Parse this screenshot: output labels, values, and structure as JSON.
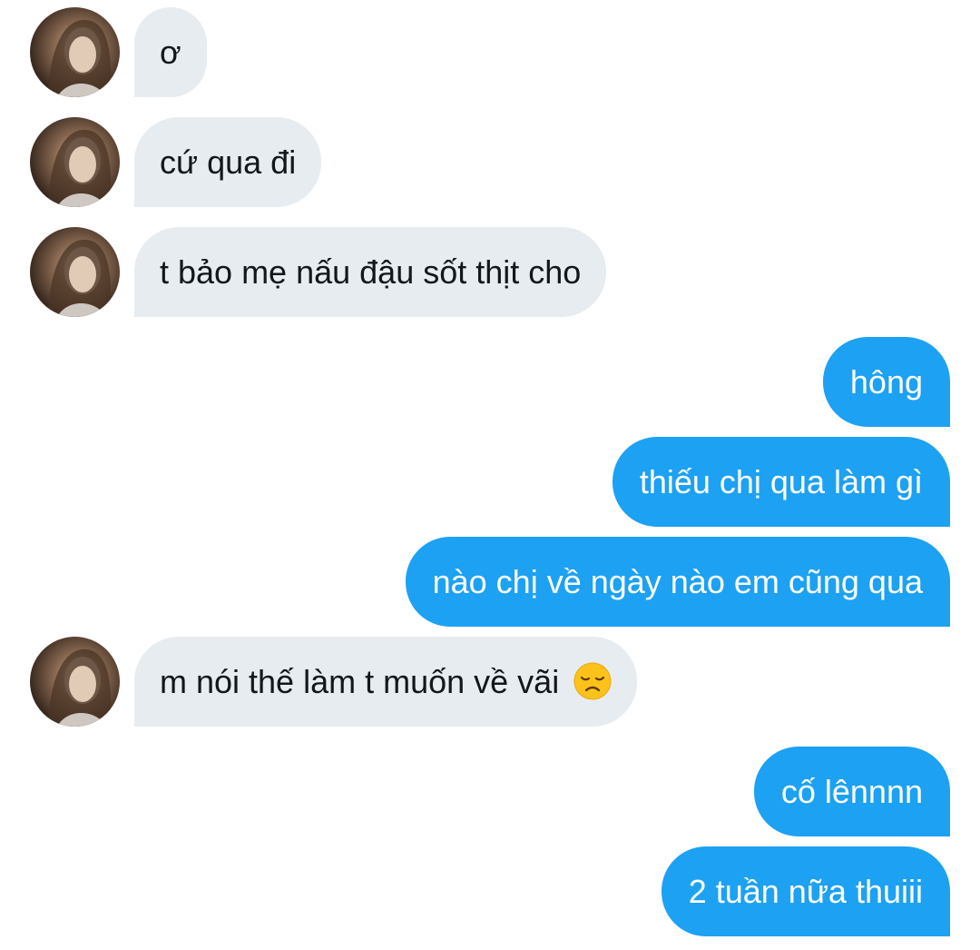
{
  "conversation": {
    "messages": [
      {
        "sender": "them",
        "text": "ơ"
      },
      {
        "sender": "them",
        "text": "cứ qua đi"
      },
      {
        "sender": "them",
        "text": "t bảo mẹ nấu đậu sốt thịt cho"
      },
      {
        "sender": "me",
        "text": "hông"
      },
      {
        "sender": "me",
        "text": "thiếu chị qua làm gì"
      },
      {
        "sender": "me",
        "text": "nào chị về ngày nào em cũng qua"
      },
      {
        "sender": "them",
        "text": "m nói thế làm t muốn về vãi",
        "emoji": "disappointed-face"
      },
      {
        "sender": "me",
        "text": "cố lênnnn"
      },
      {
        "sender": "me",
        "text": "2 tuần nữa thuiii"
      }
    ]
  },
  "colors": {
    "incoming_bubble": "#e6ecf0",
    "outgoing_bubble": "#1da1f2",
    "incoming_text": "#14171a",
    "outgoing_text": "#ffffff"
  }
}
